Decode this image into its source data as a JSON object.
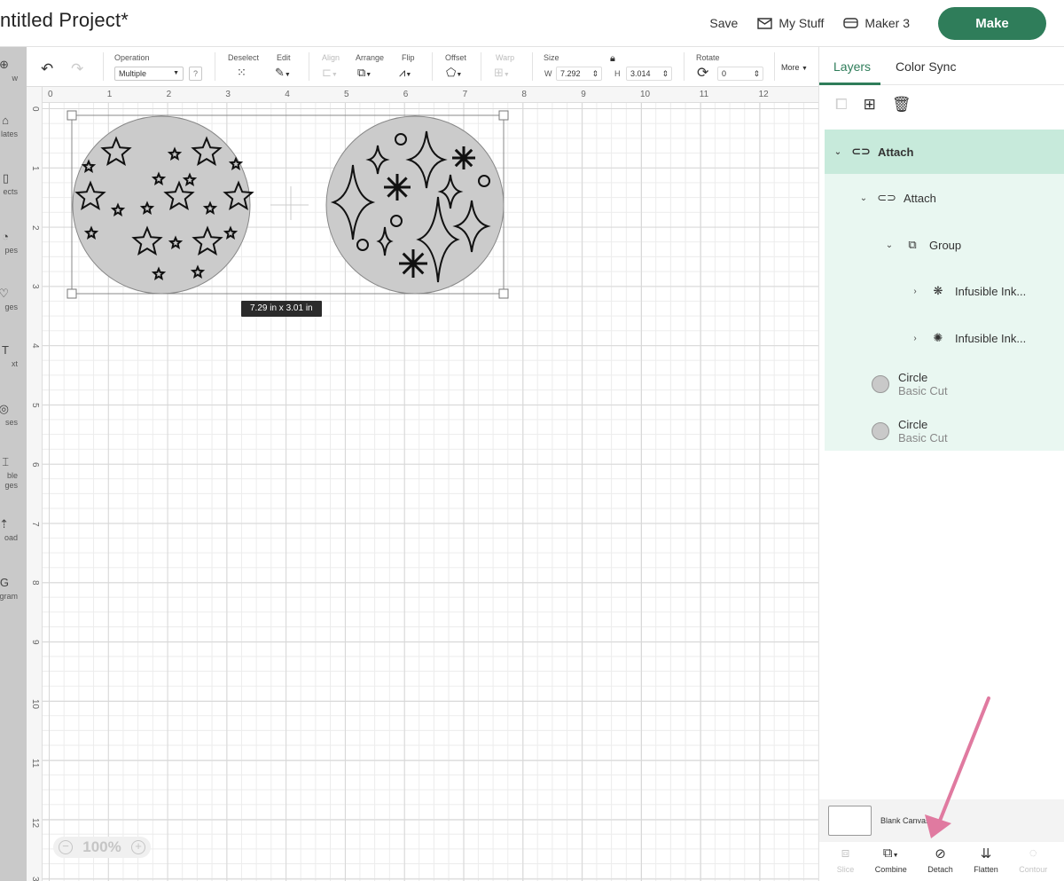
{
  "header": {
    "project_title": "ntitled Project*",
    "save_label": "Save",
    "my_stuff_label": "My Stuff",
    "machine_label": "Maker 3",
    "make_label": "Make"
  },
  "left_sidebar": {
    "items": [
      {
        "label": "w",
        "icon": "new-icon"
      },
      {
        "label": "lates",
        "icon": "templates-icon"
      },
      {
        "label": "ects",
        "icon": "projects-icon"
      },
      {
        "label": "pes",
        "icon": "shapes-icon"
      },
      {
        "label": "ges",
        "icon": "images-icon"
      },
      {
        "label": "xt",
        "icon": "text-icon"
      },
      {
        "label": "ses",
        "icon": "phrases-icon"
      },
      {
        "label": "ble\nges",
        "icon": "editable-images-icon"
      },
      {
        "label": "oad",
        "icon": "upload-icon"
      },
      {
        "label": "gram",
        "icon": "monogram-icon"
      }
    ]
  },
  "toolbar": {
    "operation_label": "Operation",
    "operation_value": "Multiple",
    "help_label": "?",
    "deselect_label": "Deselect",
    "edit_label": "Edit",
    "align_label": "Align",
    "arrange_label": "Arrange",
    "flip_label": "Flip",
    "offset_label": "Offset",
    "warp_label": "Warp",
    "size_label": "Size",
    "width_prefix": "W",
    "width_value": "7.292",
    "height_prefix": "H",
    "height_value": "3.014",
    "rotate_label": "Rotate",
    "rotate_value": "0",
    "more_label": "More"
  },
  "canvas": {
    "ruler_top": [
      "0",
      "1",
      "2",
      "3",
      "4",
      "5",
      "6",
      "7",
      "8",
      "9",
      "10",
      "11",
      "12"
    ],
    "ruler_left": [
      "0",
      "1",
      "2",
      "3",
      "4",
      "5",
      "6",
      "7",
      "8",
      "9",
      "10",
      "11",
      "12",
      "3"
    ],
    "size_badge": "7.29  in x 3.01  in",
    "zoom_level": "100%"
  },
  "right_panel": {
    "tabs": [
      {
        "label": "Layers",
        "active": true
      },
      {
        "label": "Color Sync",
        "active": false
      }
    ],
    "layers": [
      {
        "name": "Attach",
        "type": "attach",
        "level": 0
      },
      {
        "name": "Attach",
        "type": "attach",
        "level": 1
      },
      {
        "name": "Group",
        "type": "group",
        "level": 2
      },
      {
        "name": "Infusible Ink...",
        "type": "image",
        "level": 3
      },
      {
        "name": "Infusible Ink...",
        "type": "image",
        "level": 3
      },
      {
        "name": "Circle",
        "subtitle": "Basic Cut",
        "type": "shape"
      },
      {
        "name": "Circle",
        "subtitle": "Basic Cut",
        "type": "shape"
      }
    ],
    "blank_canvas_label": "Blank Canvas",
    "bottom_tools": [
      {
        "label": "Slice",
        "enabled": false
      },
      {
        "label": "Combine",
        "enabled": true
      },
      {
        "label": "Detach",
        "enabled": true
      },
      {
        "label": "Flatten",
        "enabled": true
      },
      {
        "label": "Contour",
        "enabled": false
      }
    ]
  },
  "annotation": {
    "arrow_color": "#e07aa0",
    "points_to": "Detach"
  },
  "colors": {
    "brand": "#2f7d5a",
    "layer_highlight": "#c7eadb",
    "layer_bg": "#e9f7f1"
  }
}
